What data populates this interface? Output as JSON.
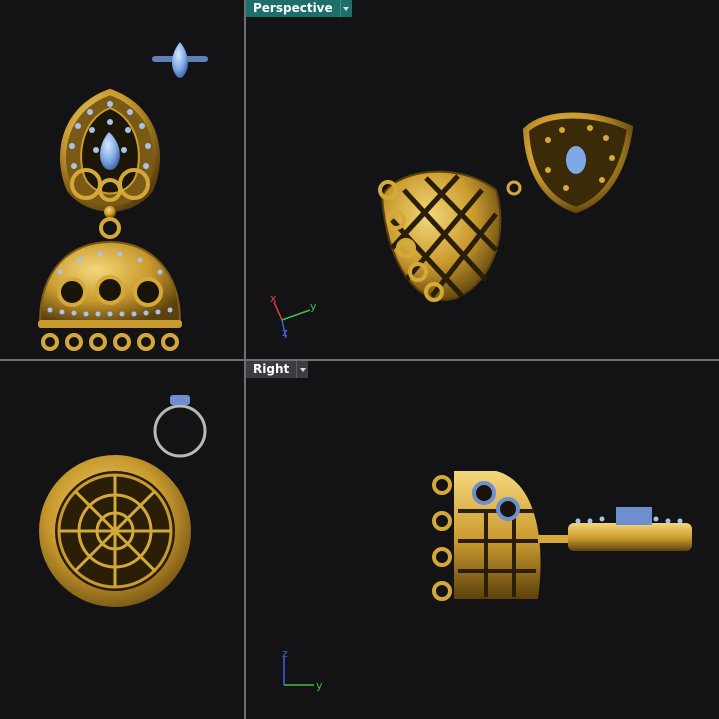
{
  "viewports": {
    "top_left": {
      "name": ""
    },
    "perspective": {
      "name": "Perspective",
      "active": true
    },
    "bottom_left": {
      "name": ""
    },
    "right": {
      "name": "Right",
      "active": false
    }
  },
  "axes": {
    "x": "x",
    "y": "y",
    "z": "z"
  },
  "colors": {
    "viewport_bg": "#131316",
    "separator": "#6f6f72",
    "gold": "#d4a93a",
    "gold_dark": "#7a5a14",
    "gem_blue": "#7fa8e6",
    "active_title": "#1e6f6a",
    "title_bg": "#3c3c42"
  },
  "icons": {
    "viewport_menu": "chevron-down-icon"
  }
}
